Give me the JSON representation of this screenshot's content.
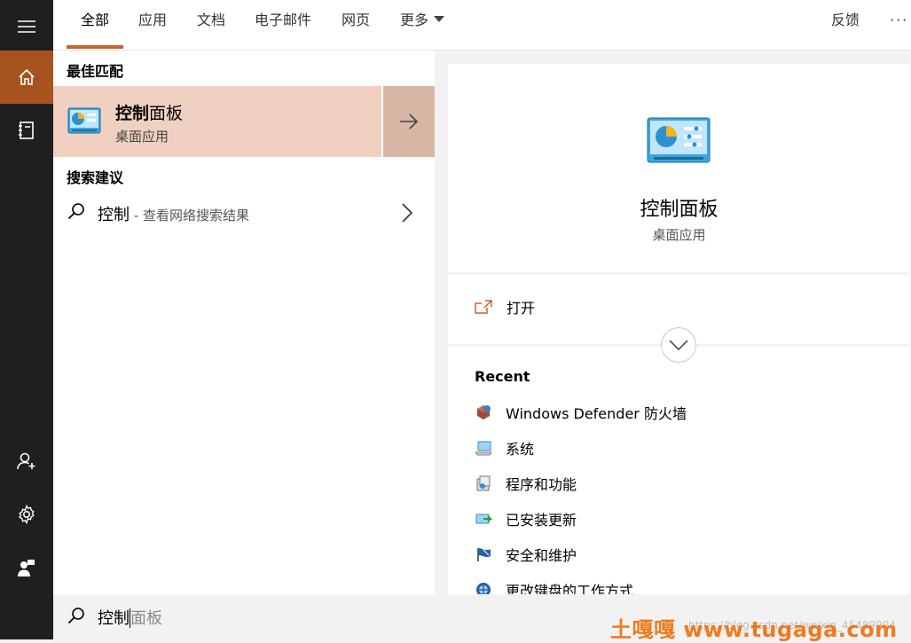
{
  "rail": {
    "items": [
      {
        "name": "menu",
        "icon": "hamburger-icon"
      },
      {
        "name": "home",
        "icon": "home-icon",
        "active": true
      },
      {
        "name": "notebook",
        "icon": "notebook-icon"
      },
      {
        "name": "account",
        "icon": "add-person-icon"
      },
      {
        "name": "settings",
        "icon": "gear-icon"
      },
      {
        "name": "feedback",
        "icon": "feedback-person-icon"
      }
    ],
    "active_color": "#a6531f"
  },
  "tabs": {
    "items": [
      "全部",
      "应用",
      "文档",
      "电子邮件",
      "网页",
      "更多"
    ],
    "active_index": 0,
    "feedback": "反馈",
    "overflow": "···",
    "accent_color": "#c9622a"
  },
  "results": {
    "best_match_title": "最佳匹配",
    "best_match": {
      "name_bold": "控制",
      "name_rest": "面板",
      "type": "桌面应用",
      "icon": "control-panel-icon",
      "open_icon": "arrow-right-icon",
      "highlight_color": "#f0d0c0"
    },
    "suggest_title": "搜索建议",
    "suggestion": {
      "query": "控制",
      "hint": " - 查看网络搜索结果",
      "icon": "search-icon"
    }
  },
  "detail": {
    "title": "控制面板",
    "subtitle": "桌面应用",
    "open_label": "打开",
    "open_icon": "open-external-icon",
    "expand_icon": "chevron-down-icon",
    "recent_title": "Recent",
    "recent": [
      {
        "label": "Windows Defender 防火墙",
        "icon": "firewall-icon"
      },
      {
        "label": "系统",
        "icon": "system-icon"
      },
      {
        "label": "程序和功能",
        "icon": "programs-icon"
      },
      {
        "label": "已安装更新",
        "icon": "updates-icon"
      },
      {
        "label": "安全和维护",
        "icon": "security-flag-icon"
      },
      {
        "label": "更改键盘的工作方式",
        "icon": "keyboard-ease-icon"
      }
    ]
  },
  "search": {
    "typed": "控制",
    "completion": "面板",
    "icon": "search-icon"
  },
  "watermark": {
    "brand": "土嘎嘎 www.tugaga.com",
    "faint": "https://blog.csdn.net/weixin_45489904"
  }
}
